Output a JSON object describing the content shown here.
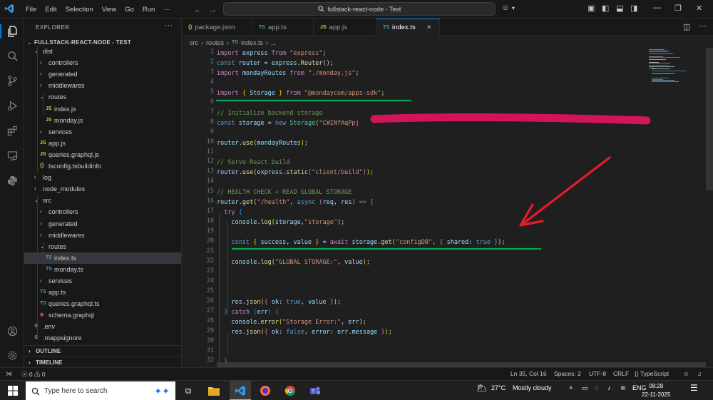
{
  "menu": [
    "File",
    "Edit",
    "Selection",
    "View",
    "Go",
    "Run"
  ],
  "command_center": "fullstack-react-node - Test",
  "explorer": {
    "title": "EXPLORER",
    "root": "FULLSTACK-REACT-NODE - TEST",
    "items": [
      {
        "label": "dist",
        "kind": "folder-open",
        "depth": 1
      },
      {
        "label": "controllers",
        "kind": "folder",
        "depth": 2
      },
      {
        "label": "generated",
        "kind": "folder",
        "depth": 2
      },
      {
        "label": "middlewares",
        "kind": "folder",
        "depth": 2
      },
      {
        "label": "routes",
        "kind": "folder-open",
        "depth": 2
      },
      {
        "label": "index.js",
        "kind": "js",
        "depth": 3
      },
      {
        "label": "monday.js",
        "kind": "js",
        "depth": 3
      },
      {
        "label": "services",
        "kind": "folder",
        "depth": 2
      },
      {
        "label": "app.js",
        "kind": "js",
        "depth": 2
      },
      {
        "label": "queries.graphql.js",
        "kind": "js",
        "depth": 2
      },
      {
        "label": "tsconfig.tsbuildinfo",
        "kind": "cfg",
        "depth": 2
      },
      {
        "label": "log",
        "kind": "folder",
        "depth": 1
      },
      {
        "label": "node_modules",
        "kind": "folder",
        "depth": 1
      },
      {
        "label": "src",
        "kind": "folder-open",
        "depth": 1
      },
      {
        "label": "controllers",
        "kind": "folder",
        "depth": 2
      },
      {
        "label": "generated",
        "kind": "folder",
        "depth": 2
      },
      {
        "label": "middlewares",
        "kind": "folder",
        "depth": 2
      },
      {
        "label": "routes",
        "kind": "folder-open",
        "depth": 2
      },
      {
        "label": "index.ts",
        "kind": "ts",
        "depth": 3,
        "selected": true
      },
      {
        "label": "monday.ts",
        "kind": "ts",
        "depth": 3
      },
      {
        "label": "services",
        "kind": "folder",
        "depth": 2
      },
      {
        "label": "app.ts",
        "kind": "ts",
        "depth": 2
      },
      {
        "label": "queries.graphql.ts",
        "kind": "ts",
        "depth": 2
      },
      {
        "label": "schema.graphql",
        "kind": "gql",
        "depth": 2
      },
      {
        "label": ".env",
        "kind": "gear",
        "depth": 1
      },
      {
        "label": ".mappsignore",
        "kind": "gear",
        "depth": 1
      }
    ],
    "sections": [
      "OUTLINE",
      "TIMELINE"
    ]
  },
  "tabs": [
    {
      "label": "package.json",
      "icon": "{}",
      "active": false
    },
    {
      "label": "app.ts",
      "icon": "TS",
      "active": false
    },
    {
      "label": "app.js",
      "icon": "JS",
      "active": false
    },
    {
      "label": "index.ts",
      "icon": "TS",
      "active": true
    }
  ],
  "breadcrumb": [
    "src",
    "routes",
    "index.ts",
    "..."
  ],
  "code_lines": [
    {
      "n": 1,
      "tokens": [
        [
          "k",
          "import "
        ],
        [
          "v",
          "express "
        ],
        [
          "k",
          "from "
        ],
        [
          "s",
          "\"express\""
        ],
        [
          "p",
          ";"
        ]
      ]
    },
    {
      "n": 2,
      "tokens": [
        [
          "kb",
          "const "
        ],
        [
          "v",
          "router "
        ],
        [
          "p",
          "= "
        ],
        [
          "v",
          "express"
        ],
        [
          "p",
          "."
        ],
        [
          "f",
          "Router"
        ],
        [
          "p",
          "();"
        ]
      ]
    },
    {
      "n": 3,
      "tokens": [
        [
          "k",
          "import "
        ],
        [
          "v",
          "mondayRoutes "
        ],
        [
          "k",
          "from "
        ],
        [
          "s",
          "\"./monday.js\""
        ],
        [
          "p",
          ";"
        ]
      ]
    },
    {
      "n": 4,
      "tokens": []
    },
    {
      "n": 5,
      "tokens": [
        [
          "k",
          "import "
        ],
        [
          "br1",
          "{ "
        ],
        [
          "v",
          "Storage "
        ],
        [
          "br1",
          "} "
        ],
        [
          "k",
          "from "
        ],
        [
          "s",
          "\"@mondaycom/apps-sdk\""
        ],
        [
          "p",
          ";"
        ]
      ]
    },
    {
      "n": 6,
      "tokens": []
    },
    {
      "n": 7,
      "tokens": [
        [
          "c",
          "// Initialize backend storage"
        ]
      ]
    },
    {
      "n": 8,
      "tokens": [
        [
          "kb",
          "const "
        ],
        [
          "v",
          "storage "
        ],
        [
          "p",
          "= "
        ],
        [
          "kb",
          "new "
        ],
        [
          "t",
          "Storage"
        ],
        [
          "br1",
          "("
        ],
        [
          "s",
          "\"CWINfAqPpj"
        ]
      ]
    },
    {
      "n": 9,
      "tokens": []
    },
    {
      "n": 10,
      "tokens": [
        [
          "v",
          "router"
        ],
        [
          "p",
          "."
        ],
        [
          "f",
          "use"
        ],
        [
          "br1",
          "("
        ],
        [
          "v",
          "mondayRoutes"
        ],
        [
          "br1",
          ")"
        ],
        [
          "p",
          ";"
        ]
      ]
    },
    {
      "n": 11,
      "tokens": []
    },
    {
      "n": 12,
      "tokens": [
        [
          "c",
          "// Serve React build"
        ]
      ]
    },
    {
      "n": 13,
      "tokens": [
        [
          "v",
          "router"
        ],
        [
          "p",
          "."
        ],
        [
          "f",
          "use"
        ],
        [
          "br1",
          "("
        ],
        [
          "v",
          "express"
        ],
        [
          "p",
          "."
        ],
        [
          "f",
          "static"
        ],
        [
          "br2",
          "("
        ],
        [
          "s",
          "\"client/build\""
        ],
        [
          "br2",
          ")"
        ],
        [
          "br1",
          ")"
        ],
        [
          "p",
          ";"
        ]
      ]
    },
    {
      "n": 14,
      "tokens": []
    },
    {
      "n": 15,
      "tokens": [
        [
          "c",
          "// HEALTH CHECK + READ GLOBAL STORAGE"
        ]
      ]
    },
    {
      "n": 16,
      "tokens": [
        [
          "v",
          "router"
        ],
        [
          "p",
          "."
        ],
        [
          "f",
          "get"
        ],
        [
          "br1",
          "("
        ],
        [
          "s",
          "\"/health\""
        ],
        [
          "p",
          ", "
        ],
        [
          "kb",
          "async "
        ],
        [
          "br2",
          "("
        ],
        [
          "v",
          "req"
        ],
        [
          "p",
          ", "
        ],
        [
          "v",
          "res"
        ],
        [
          "br2",
          ") "
        ],
        [
          "kb",
          "=> "
        ],
        [
          "br2",
          "{"
        ]
      ]
    },
    {
      "n": 17,
      "tokens": [
        [
          "p",
          "  "
        ],
        [
          "k",
          "try "
        ],
        [
          "br3",
          "{"
        ]
      ]
    },
    {
      "n": 18,
      "tokens": [
        [
          "p",
          "    "
        ],
        [
          "v",
          "console"
        ],
        [
          "p",
          "."
        ],
        [
          "f",
          "log"
        ],
        [
          "br1",
          "("
        ],
        [
          "v",
          "storage"
        ],
        [
          "p",
          ","
        ],
        [
          "s",
          "\"storage\""
        ],
        [
          "br1",
          ")"
        ],
        [
          "p",
          ";"
        ]
      ]
    },
    {
      "n": 19,
      "tokens": []
    },
    {
      "n": 20,
      "tokens": [
        [
          "p",
          "    "
        ],
        [
          "kb",
          "const "
        ],
        [
          "br1",
          "{ "
        ],
        [
          "v",
          "success"
        ],
        [
          "p",
          ", "
        ],
        [
          "v",
          "value "
        ],
        [
          "br1",
          "} "
        ],
        [
          "p",
          "= "
        ],
        [
          "k",
          "await "
        ],
        [
          "v",
          "storage"
        ],
        [
          "p",
          "."
        ],
        [
          "f",
          "get"
        ],
        [
          "br1",
          "("
        ],
        [
          "s",
          "\"configDB\""
        ],
        [
          "p",
          ", "
        ],
        [
          "br2",
          "{ "
        ],
        [
          "v",
          "shared"
        ],
        [
          "p",
          ": "
        ],
        [
          "kb",
          "true "
        ],
        [
          "br2",
          "}"
        ],
        [
          "br1",
          ")"
        ],
        [
          "p",
          ";"
        ]
      ]
    },
    {
      "n": 21,
      "tokens": []
    },
    {
      "n": 22,
      "tokens": [
        [
          "p",
          "    "
        ],
        [
          "v",
          "console"
        ],
        [
          "p",
          "."
        ],
        [
          "f",
          "log"
        ],
        [
          "br1",
          "("
        ],
        [
          "s",
          "\"GLOBAL STORAGE:\""
        ],
        [
          "p",
          ", "
        ],
        [
          "v",
          "value"
        ],
        [
          "br1",
          ")"
        ],
        [
          "p",
          ";"
        ]
      ]
    },
    {
      "n": 23,
      "tokens": []
    },
    {
      "n": 24,
      "tokens": []
    },
    {
      "n": 25,
      "tokens": []
    },
    {
      "n": 26,
      "tokens": [
        [
          "p",
          "    "
        ],
        [
          "v",
          "res"
        ],
        [
          "p",
          "."
        ],
        [
          "f",
          "json"
        ],
        [
          "br1",
          "("
        ],
        [
          "br2",
          "{ "
        ],
        [
          "v",
          "ok"
        ],
        [
          "p",
          ": "
        ],
        [
          "kb",
          "true"
        ],
        [
          "p",
          ", "
        ],
        [
          "v",
          "value "
        ],
        [
          "br2",
          "}"
        ],
        [
          "br1",
          ")"
        ],
        [
          "p",
          ";"
        ]
      ]
    },
    {
      "n": 27,
      "tokens": [
        [
          "p",
          "  "
        ],
        [
          "br3",
          "} "
        ],
        [
          "k",
          "catch "
        ],
        [
          "br3",
          "("
        ],
        [
          "v",
          "err"
        ],
        [
          "br3",
          ") "
        ],
        [
          "br3",
          "{"
        ]
      ]
    },
    {
      "n": 28,
      "tokens": [
        [
          "p",
          "    "
        ],
        [
          "v",
          "console"
        ],
        [
          "p",
          "."
        ],
        [
          "f",
          "error"
        ],
        [
          "br1",
          "("
        ],
        [
          "s",
          "\"Storage Error:\""
        ],
        [
          "p",
          ", "
        ],
        [
          "v",
          "err"
        ],
        [
          "br1",
          ")"
        ],
        [
          "p",
          ";"
        ]
      ]
    },
    {
      "n": 29,
      "tokens": [
        [
          "p",
          "    "
        ],
        [
          "v",
          "res"
        ],
        [
          "p",
          "."
        ],
        [
          "f",
          "json"
        ],
        [
          "br1",
          "("
        ],
        [
          "br2",
          "{ "
        ],
        [
          "v",
          "ok"
        ],
        [
          "p",
          ": "
        ],
        [
          "kb",
          "false"
        ],
        [
          "p",
          ", "
        ],
        [
          "v",
          "error"
        ],
        [
          "p",
          ": "
        ],
        [
          "v",
          "err"
        ],
        [
          "p",
          "."
        ],
        [
          "v",
          "message "
        ],
        [
          "br2",
          "}"
        ],
        [
          "br1",
          ")"
        ],
        [
          "p",
          ";"
        ]
      ]
    },
    {
      "n": 30,
      "tokens": []
    },
    {
      "n": 31,
      "tokens": []
    },
    {
      "n": 32,
      "tokens": [
        [
          "p",
          "  "
        ],
        [
          "br3",
          "}"
        ]
      ]
    }
  ],
  "colors": {
    "underline": "#00a651",
    "redaction": "#d4145a",
    "arrow": "#e8192c",
    "accent": "#0078d4"
  },
  "status": {
    "errors": "0",
    "warnings": "0",
    "position": "Ln 35, Col 16",
    "spaces": "Spaces: 2",
    "encoding": "UTF-8",
    "eol": "CRLF",
    "language": "TypeScript"
  },
  "taskbar": {
    "search_placeholder": "Type here to search",
    "weather_temp": "27°C",
    "weather_text": "Mostly cloudy",
    "lang": "ENG",
    "time": "08:28",
    "date": "22-11-2025"
  }
}
